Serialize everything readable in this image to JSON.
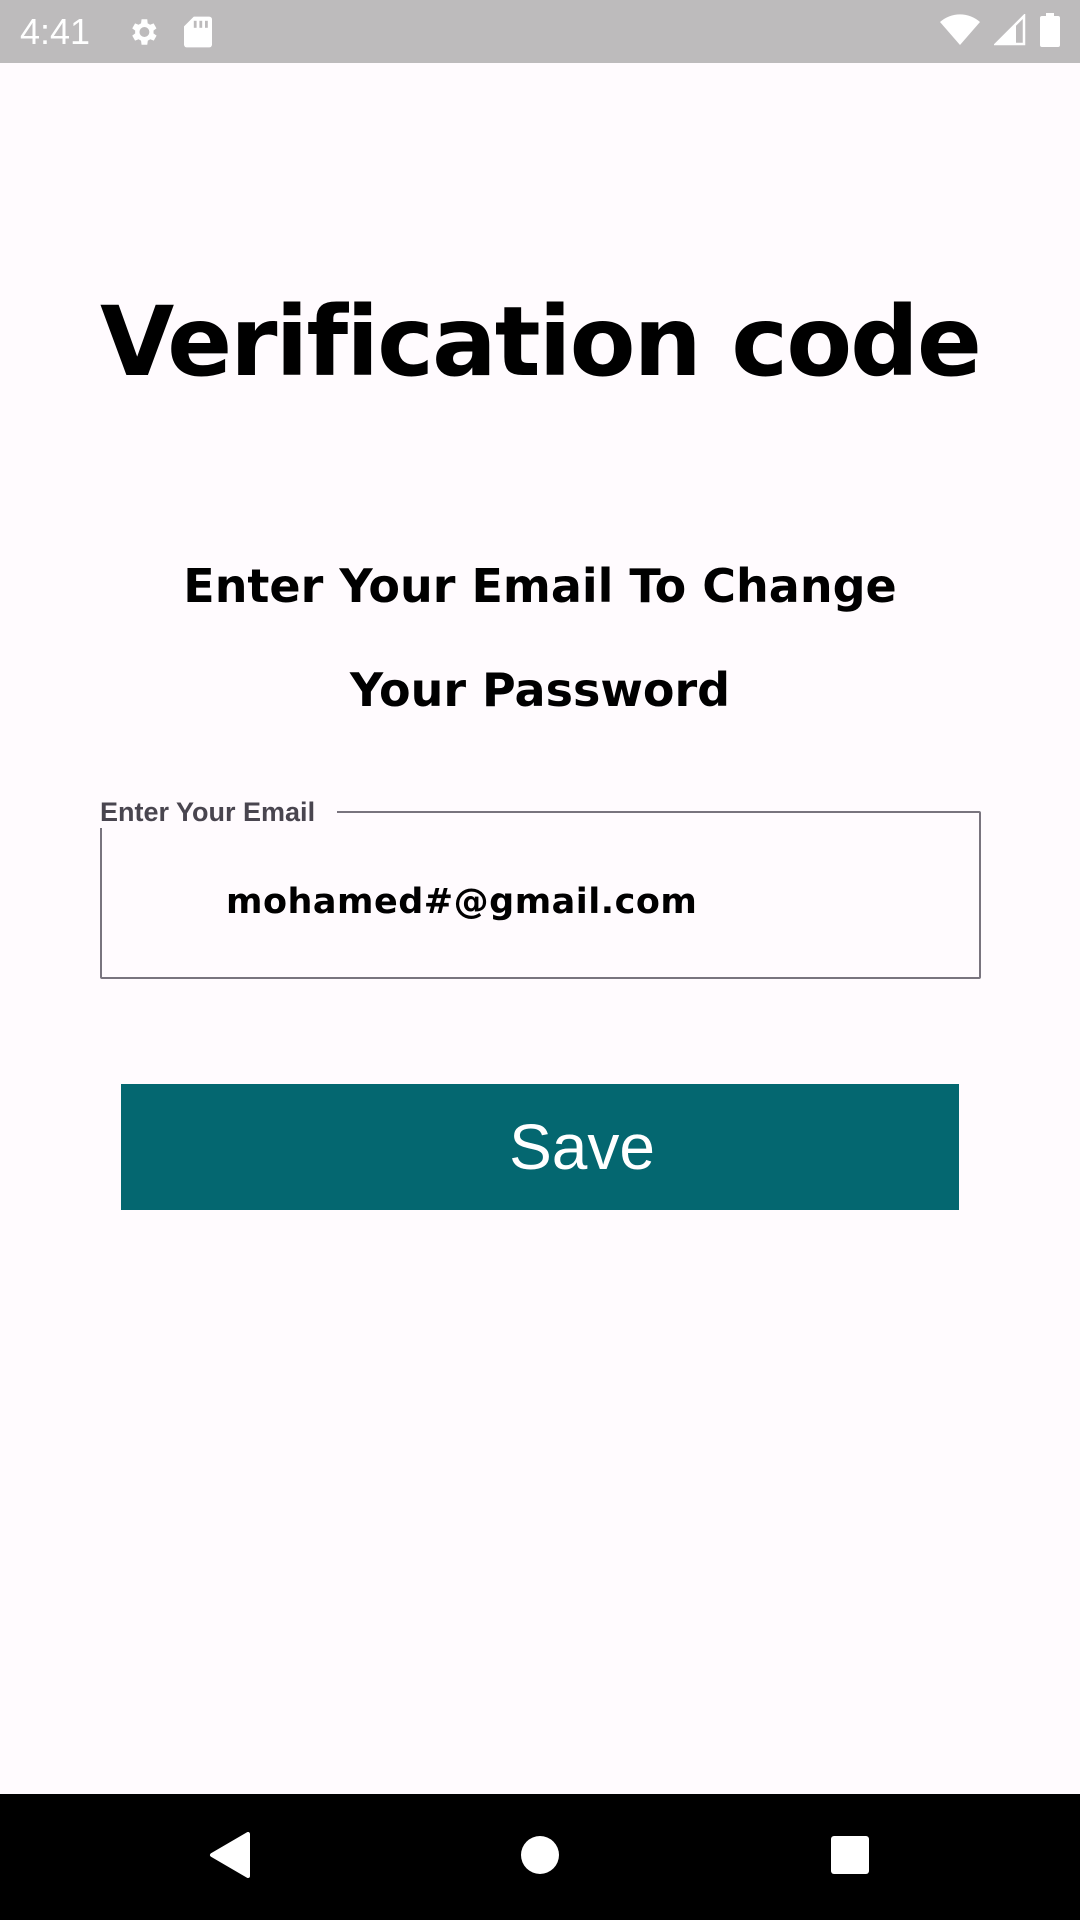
{
  "status_bar": {
    "time": "4:41",
    "left_icons": [
      "settings-icon",
      "sd-card-icon"
    ],
    "right_icons": [
      "wifi-icon",
      "signal-icon",
      "battery-icon"
    ],
    "background": "#bdbbbc"
  },
  "page": {
    "title": "Verification code",
    "subtitle": "Enter Your Email To Change Your Password"
  },
  "email_field": {
    "label": "Enter Your Email",
    "value": "mohamed#@gmail.com",
    "border_color": "#79747e"
  },
  "save_button": {
    "label": "Save",
    "background": "#046770",
    "text_color": "#ffffff"
  },
  "nav_bar": {
    "buttons": [
      "back-icon",
      "home-icon",
      "recents-icon"
    ],
    "background": "#000000"
  }
}
